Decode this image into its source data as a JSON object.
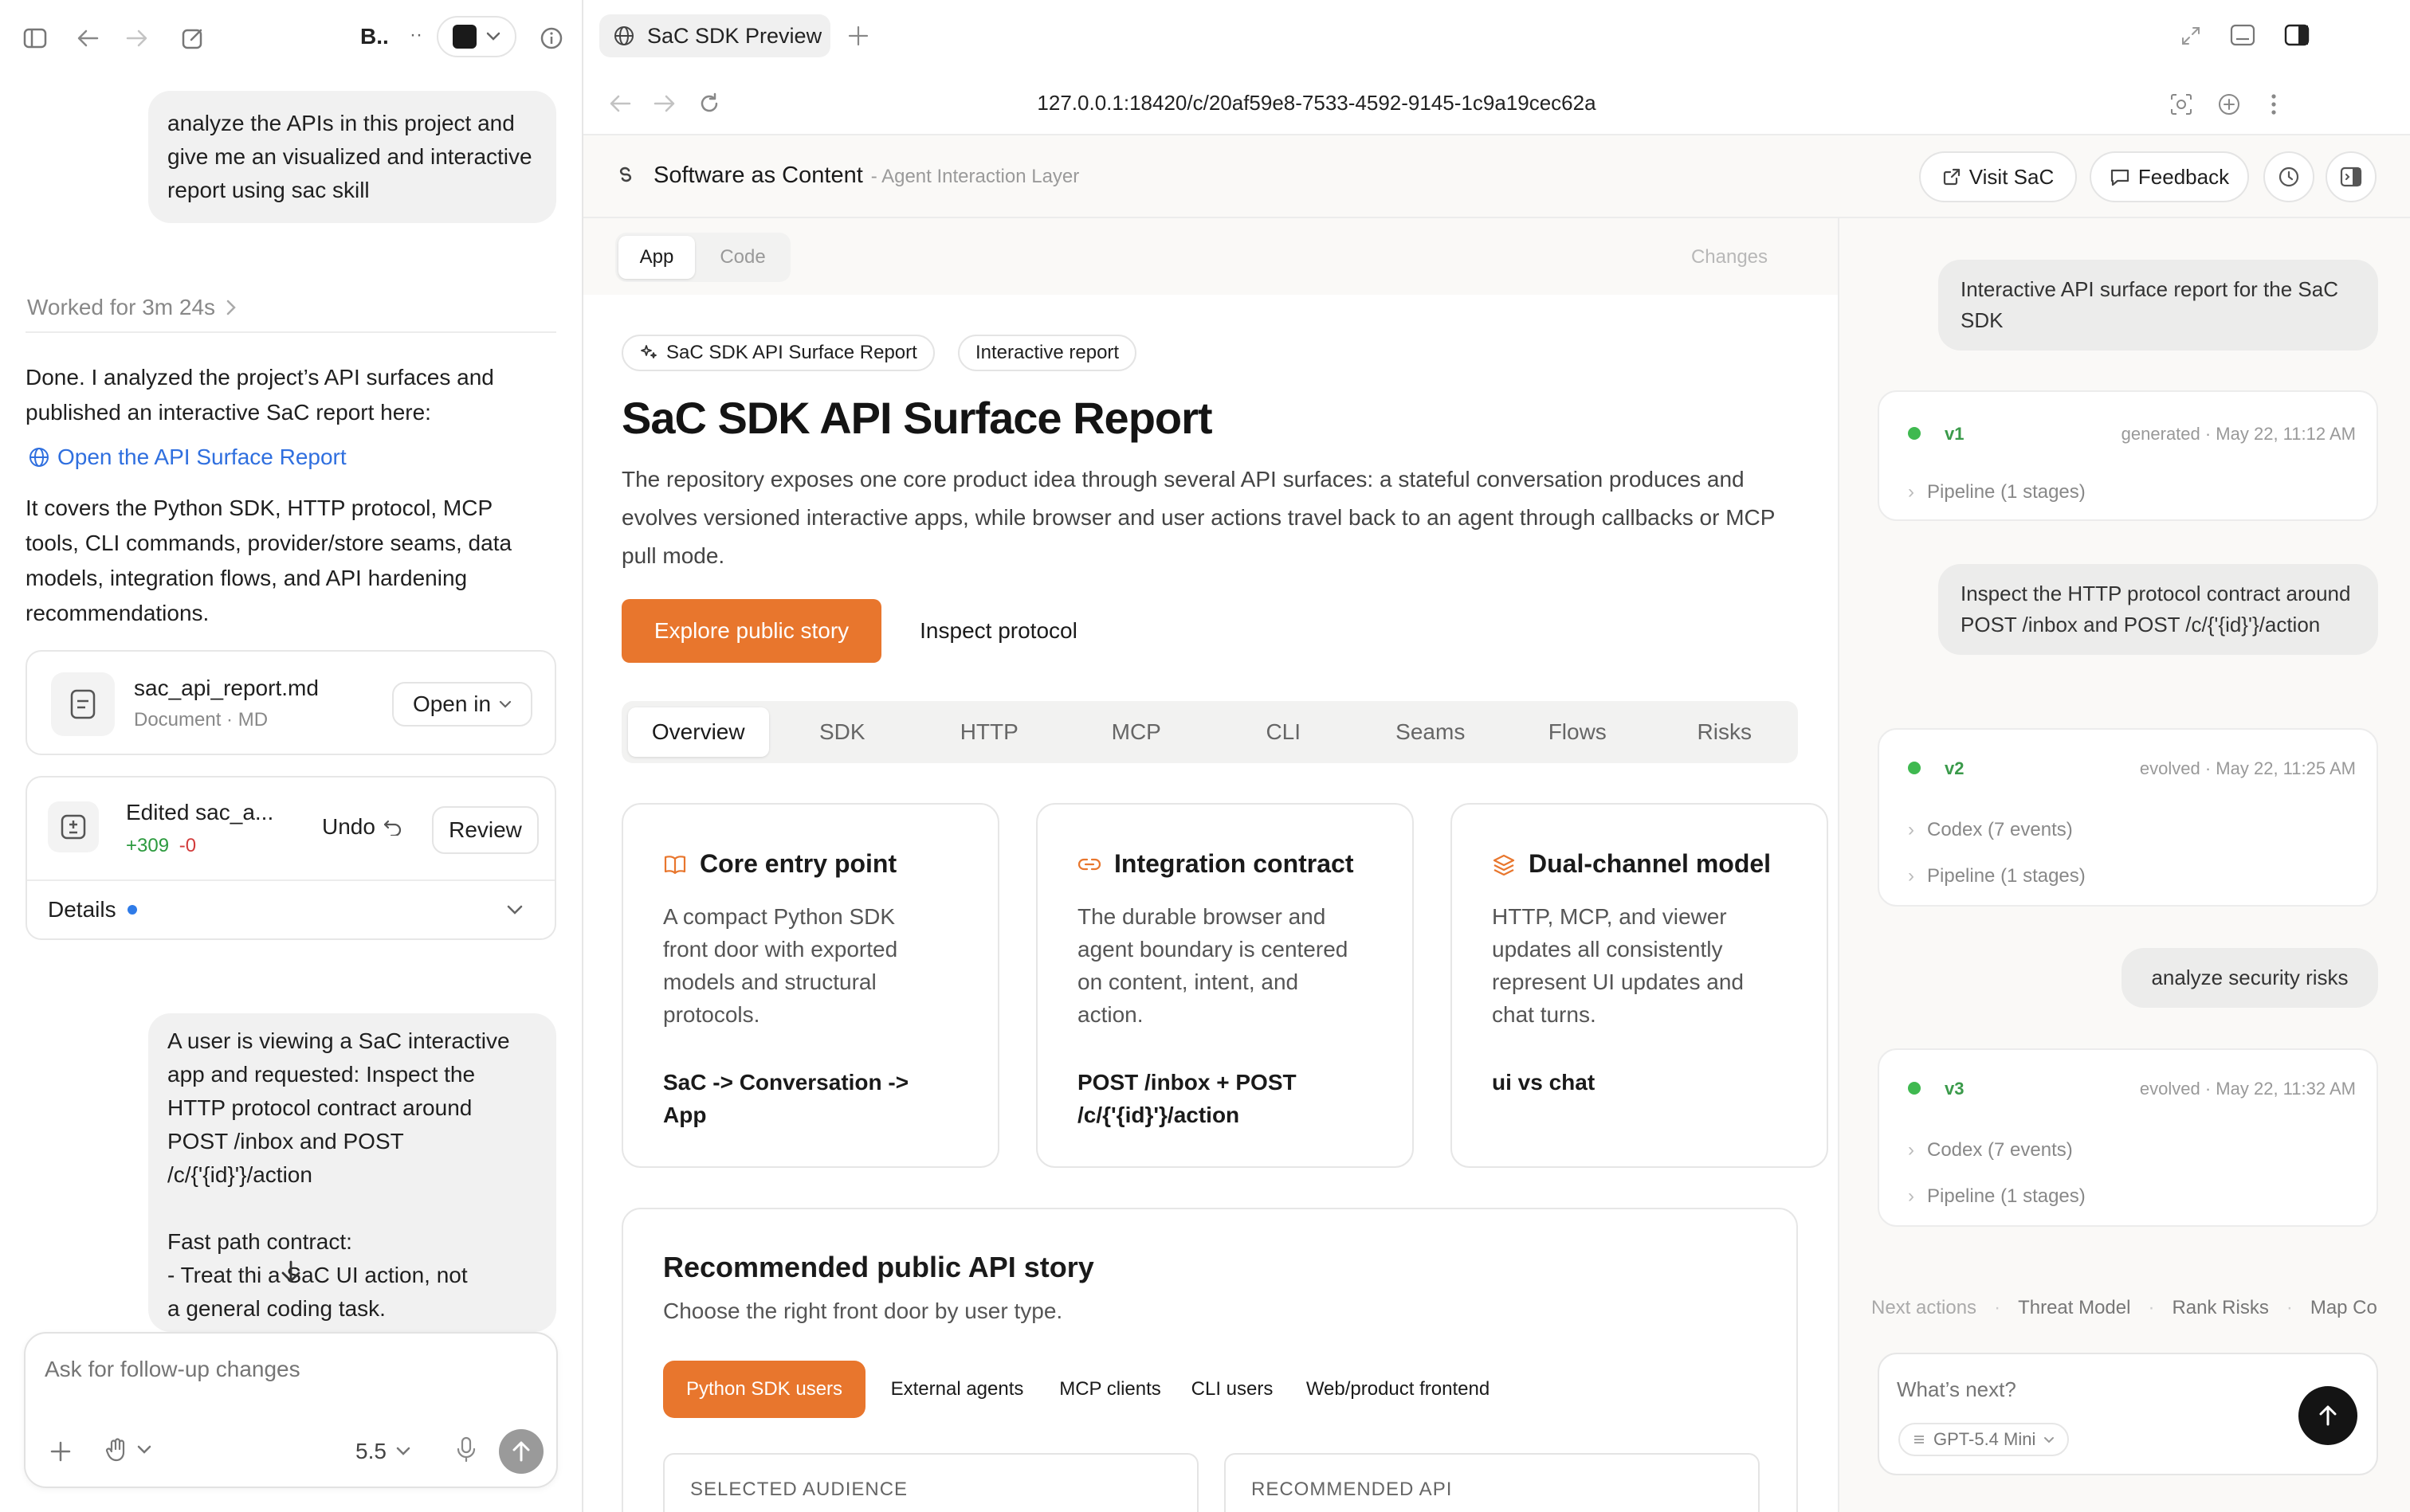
{
  "left": {
    "toolbar": {
      "title": "B..",
      "sep": "··"
    },
    "user_msg_1": "analyze the APIs in this project and give me an visualized and interactive report using sac skill",
    "worked_for": "Worked for 3m 24s",
    "reply_text": "Done. I analyzed the project’s API surfaces and published an interactive SaC report here:",
    "report_link": "Open the API Surface Report",
    "covers_text": "It covers the Python SDK, HTTP protocol, MCP tools, CLI commands, provider/store seams, data models, integration flows, and API hardening recommendations.",
    "file": {
      "name": "sac_api_report.md",
      "meta": "Document · MD",
      "open_label": "Open in"
    },
    "edited": {
      "name": "Edited sac_a...",
      "added": "+309",
      "removed": "-0",
      "undo": "Undo",
      "review": "Review"
    },
    "details": "Details",
    "user_msg_2_lines": [
      "A user is viewing a SaC interactive",
      "app and requested: Inspect the",
      "HTTP protocol contract around",
      "POST /inbox and POST",
      "/c/{'{id}'}/action",
      "",
      "Fast path contract:",
      "- Treat thi a SaC UI action, not",
      "a general coding task."
    ],
    "composer": {
      "placeholder": "Ask for follow-up changes",
      "model": "5.5"
    }
  },
  "browser": {
    "tab_title": "SaC SDK Preview",
    "url": "127.0.0.1:18420/c/20af59e8-7533-4592-9145-1c9a19cec62a"
  },
  "app_header": {
    "title": "Software as Content",
    "subtitle": "- Agent Interaction Layer",
    "visit": "Visit SaC",
    "feedback": "Feedback"
  },
  "view_tabs": {
    "app": "App",
    "code": "Code",
    "changes": "Changes"
  },
  "report": {
    "pill_1": "SaC SDK API Surface Report",
    "pill_2": "Interactive report",
    "title": "SaC SDK API Surface Report",
    "intro": "The repository exposes one core product idea through several API surfaces: a stateful conversation produces and evolves versioned interactive apps, while browser and user actions travel back to an agent through callbacks or MCP pull mode.",
    "primary_btn": "Explore public story",
    "secondary_btn": "Inspect protocol",
    "tabs": [
      "Overview",
      "SDK",
      "HTTP",
      "MCP",
      "CLI",
      "Seams",
      "Flows",
      "Risks"
    ],
    "cards": [
      {
        "title": "Core entry point",
        "lines": [
          "A compact Python SDK",
          "front door with exported",
          "models and structural",
          "protocols."
        ],
        "code_lines": [
          "SaC -> Conversation ->",
          "App"
        ]
      },
      {
        "title": "Integration contract",
        "lines": [
          "The durable browser and",
          "agent boundary is centered",
          "on content, intent, and",
          "action."
        ],
        "code_lines": [
          "POST /inbox + POST",
          "/c/{'{id}'}/action"
        ]
      },
      {
        "title": "Dual-channel model",
        "lines": [
          "HTTP, MCP, and viewer",
          "updates all consistently",
          "represent UI updates and",
          "chat turns."
        ],
        "code_lines": [
          "ui vs chat"
        ]
      }
    ],
    "story": {
      "title": "Recommended public API story",
      "subtitle": "Choose the right front door by user type.",
      "audiences": [
        "Python SDK users",
        "External agents",
        "MCP clients",
        "CLI users",
        "Web/product frontend"
      ],
      "selected_label": "SELECTED AUDIENCE",
      "recommended_label": "RECOMMENDED API"
    }
  },
  "sidebar": {
    "msg_1": "Interactive API surface report for the SaC SDK",
    "v1": {
      "tag": "v1",
      "meta": "generated · May 22, 11:12 AM",
      "rows": [
        "Pipeline (1 stages)"
      ]
    },
    "msg_2": "Inspect the HTTP protocol contract around POST /inbox and POST /c/{'{id}'}/action",
    "v2": {
      "tag": "v2",
      "meta": "evolved · May 22, 11:25 AM",
      "rows": [
        "Codex (7 events)",
        "Pipeline (1 stages)"
      ]
    },
    "msg_3": "analyze security risks",
    "v3": {
      "tag": "v3",
      "meta": "evolved · May 22, 11:32 AM",
      "rows": [
        "Codex (7 events)",
        "Pipeline (1 stages)"
      ]
    },
    "next_actions": {
      "label": "Next actions",
      "items": [
        "Threat Model",
        "Rank Risks",
        "Map Co"
      ]
    },
    "composer": {
      "placeholder": "What’s next?",
      "model": "GPT-5.4 Mini"
    }
  },
  "colors": {
    "accent": "#e8762d",
    "link": "#2f6fdf",
    "green": "#3fb950",
    "red": "#d23b3b"
  }
}
